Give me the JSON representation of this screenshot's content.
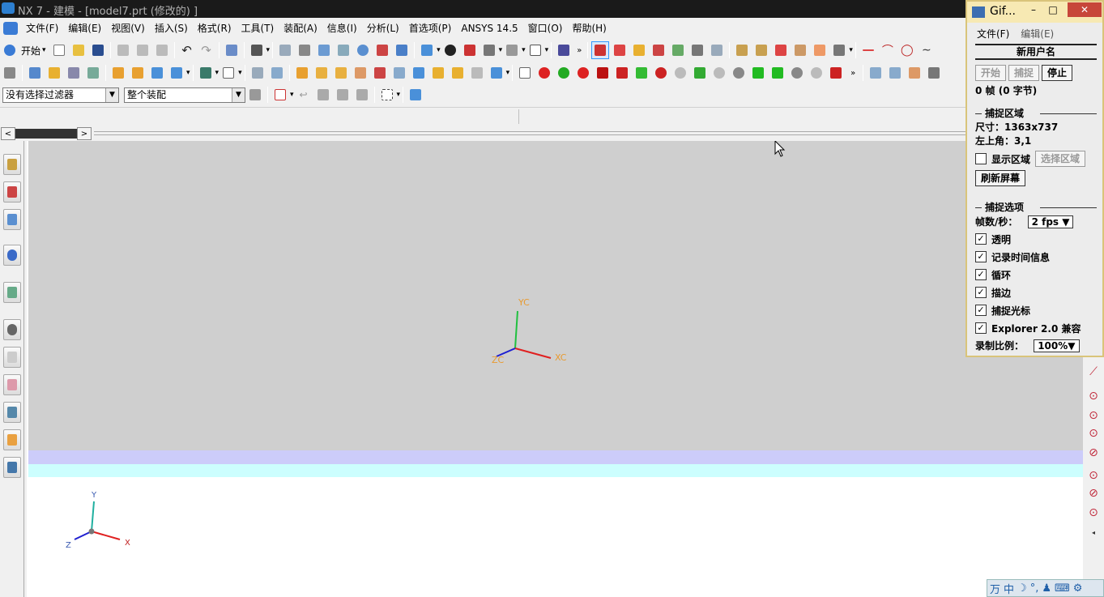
{
  "window": {
    "title": "NX 7 - 建模 - [model7.prt  (修改的) ]"
  },
  "menubar": {
    "items": [
      "文件(F)",
      "编辑(E)",
      "视图(V)",
      "插入(S)",
      "格式(R)",
      "工具(T)",
      "装配(A)",
      "信息(I)",
      "分析(L)",
      "首选项(P)",
      "ANSYS 14.5",
      "窗口(O)",
      "帮助(H)"
    ]
  },
  "toolbar1": {
    "start_label": "开始"
  },
  "toolbar3": {
    "filter_select": "没有选择过滤器",
    "scope_select": "整个装配"
  },
  "graphics": {
    "wcs": {
      "x_label": "XC",
      "y_label": "YC",
      "z_label": "ZC"
    },
    "abs_csys": {
      "x_label": "X",
      "y_label": "Y",
      "z_label": "Z"
    },
    "colors": {
      "background": "#cfcfcf",
      "x_axis": "#e02020",
      "y_axis": "#20c040",
      "z_axis": "#2020d0",
      "label_orange": "#e89a30"
    }
  },
  "gif_window": {
    "title": "Gif...",
    "menu": [
      "文件(F)",
      "编辑(E)"
    ],
    "username": "新用户名",
    "buttons": {
      "start": "开始",
      "capture": "捕捉",
      "stop": "停止"
    },
    "frames": "0 帧 (0 字节)",
    "capture_area": {
      "section_title": "捕捉区域",
      "size": "尺寸：1363x737",
      "top_left": "左上角：3,1",
      "show_area": "显示区域",
      "select_area": "选择区域",
      "refresh": "刷新屏幕"
    },
    "capture_options": {
      "section_title": "捕捉选项",
      "fps_label": "帧数/秒：",
      "fps_value": "2 fps",
      "transparent": "透明",
      "record_time": "记录时间信息",
      "loop": "循环",
      "stroke": "描边",
      "capture_cursor": "捕捉光标",
      "explorer": "Explorer 2.0 兼容",
      "scale_label": "录制比例：",
      "scale_value": "100%"
    }
  },
  "tray": {
    "ime": "中"
  }
}
